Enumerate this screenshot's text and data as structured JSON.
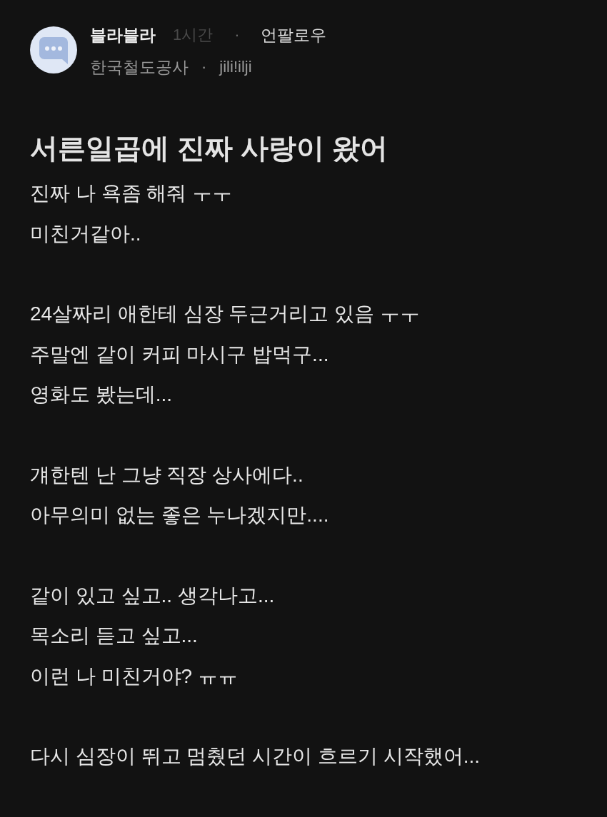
{
  "post": {
    "author": {
      "name": "블라블라",
      "time": "1시간",
      "separator": "·",
      "action": "언팔로우"
    },
    "meta": {
      "company": "한국철도공사",
      "separator": "·",
      "handle": "jili!ilji"
    },
    "title": "서른일곱에 진짜 사랑이 왔어",
    "paragraphs": [
      [
        "진짜 나 욕좀 해줘 ㅜㅜ",
        "미친거같아.."
      ],
      [
        "24살짜리 애한테 심장 두근거리고 있음 ㅜㅜ",
        "주말엔 같이 커피 마시구 밥먹구...",
        "영화도 봤는데..."
      ],
      [
        "걔한텐 난 그냥 직장 상사에다..",
        "아무의미 없는 좋은 누나겠지만...."
      ],
      [
        "같이 있고 싶고.. 생각나고...",
        "목소리 듣고 싶고...",
        "이런 나 미친거야? ㅠㅠ"
      ],
      [
        "다시 심장이 뛰고 멈췄던 시간이 흐르기 시작했어..."
      ]
    ]
  }
}
